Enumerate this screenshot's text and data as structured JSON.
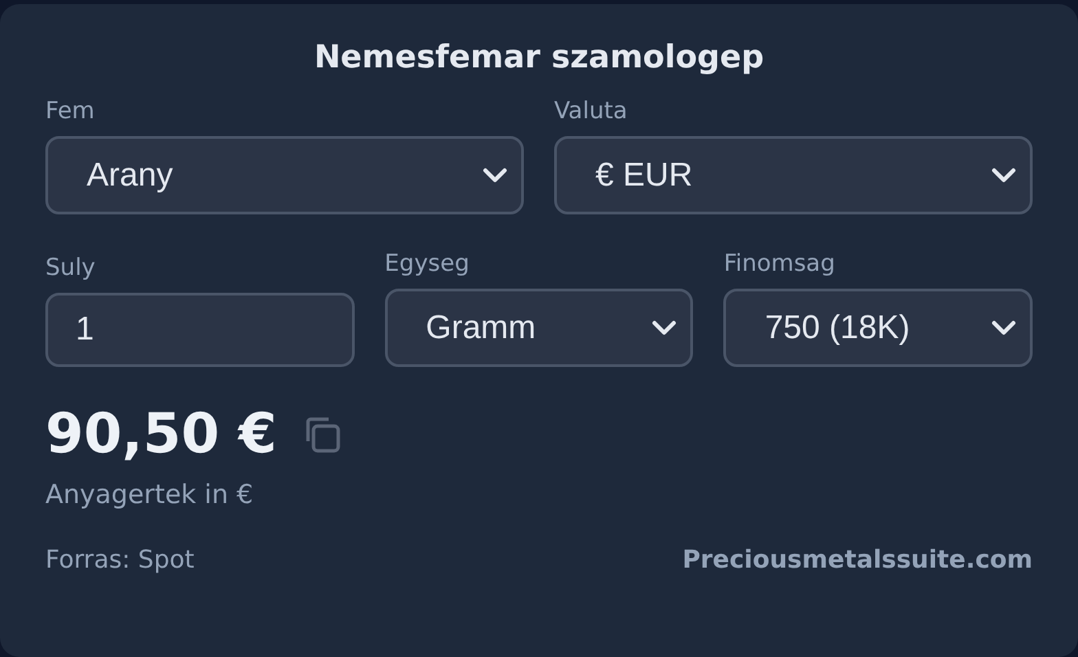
{
  "title": "Nemesfemar szamologep",
  "rows": [
    [
      {
        "label": "Fem",
        "kind": "select",
        "value": "Arany"
      },
      {
        "label": "Valuta",
        "kind": "select",
        "value": "€ EUR"
      }
    ],
    [
      {
        "label": "Suly",
        "kind": "input",
        "value": "1"
      },
      {
        "label": "Egyseg",
        "kind": "select",
        "value": "Gramm"
      },
      {
        "label": "Finomsag",
        "kind": "select",
        "value": "750 (18K)"
      }
    ]
  ],
  "result": {
    "value": "90,50 €",
    "caption": "Anyagertek in €"
  },
  "footer": {
    "source": "Forras: Spot",
    "link": "Preciousmetalssuite.com"
  }
}
